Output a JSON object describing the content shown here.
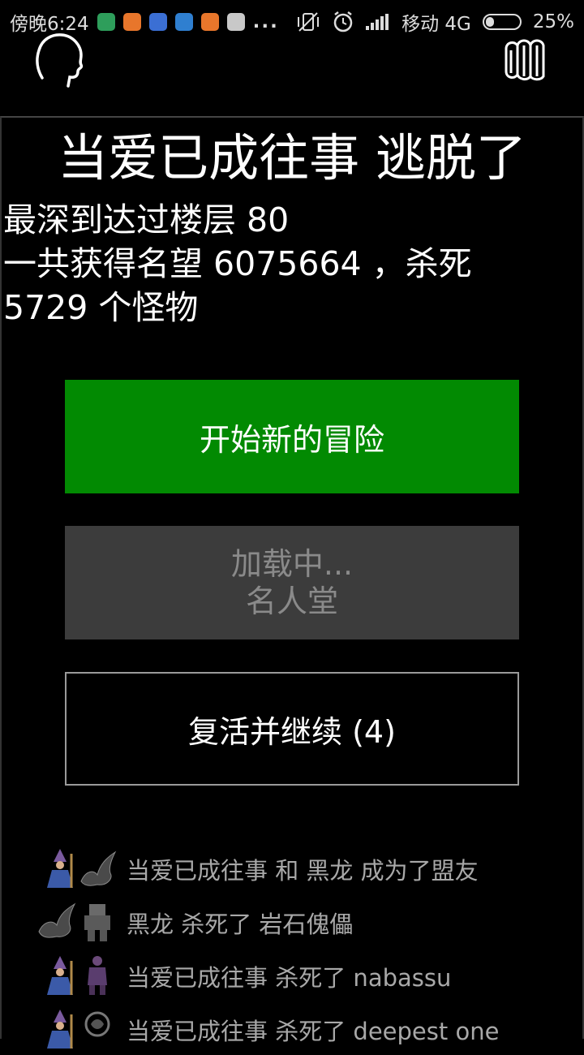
{
  "status_bar": {
    "time": "傍晚6:24",
    "more": "...",
    "carrier": "移动 4G",
    "battery_percent": "25%",
    "battery_level": 0.25,
    "app_icons": [
      "shield-app-icon",
      "chat-app-icon",
      "bird-app-icon",
      "doc-app-icon",
      "chat-app-icon",
      "play-store-icon"
    ],
    "app_colors": [
      "#2e9e5b",
      "#e8762b",
      "#3b6fd4",
      "#2f7fd0",
      "#e8762b",
      "#c8c8c8"
    ]
  },
  "header": {
    "title": "当爱已成往事 逃脱了"
  },
  "stats": {
    "line1": "最深到达过楼层 80",
    "line2": "一共获得名望 6075664 ，杀死",
    "line3": "5729 个怪物"
  },
  "buttons": {
    "new_adventure": "开始新的冒险",
    "hall_loading": "加载中...",
    "hall_of_fame": "名人堂",
    "revive": "复活并继续 (4)"
  },
  "colors": {
    "primary_button": "#028a02",
    "disabled_button": "#3c3c3c",
    "log_text": "#a8a8a8"
  },
  "log": [
    {
      "text": "当爱已成往事 和 黑龙 成为了盟友",
      "icons": [
        "wizard-sprite-icon",
        "black-dragon-sprite-icon"
      ]
    },
    {
      "text": "黑龙 杀死了 岩石傀儡",
      "icons": [
        "black-dragon-sprite-icon",
        "stone-golem-sprite-icon"
      ]
    },
    {
      "text": "当爱已成往事 杀死了 nabassu",
      "icons": [
        "wizard-sprite-icon",
        "nabassu-sprite-icon"
      ]
    },
    {
      "text": "当爱已成往事 杀死了 deepest one",
      "icons": [
        "wizard-sprite-icon",
        "deepest-one-sprite-icon"
      ]
    }
  ]
}
